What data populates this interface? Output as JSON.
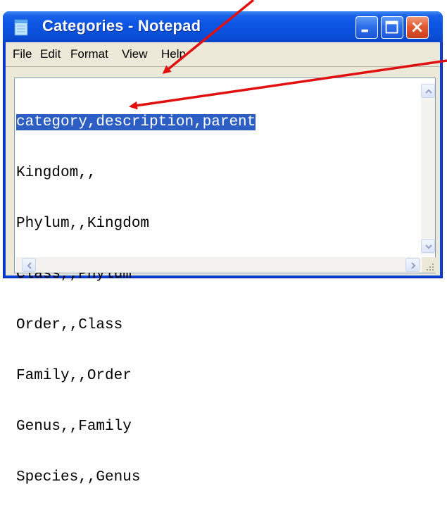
{
  "window": {
    "title": "Categories - Notepad",
    "app_icon": "notepad-icon",
    "controls": [
      "minimize-icon",
      "maximize-icon",
      "close-icon"
    ]
  },
  "menubar": {
    "items": [
      "File",
      "Edit",
      "Format",
      "View",
      "Help"
    ]
  },
  "editor": {
    "lines": [
      "category,description,parent",
      "Kingdom,,",
      "Phylum,,Kingdom",
      "Class,,Phylum",
      "Order,,Class",
      "Family,,Order",
      "Genus,,Family",
      "Species,,Genus"
    ],
    "selected_line": "category,description,parent"
  },
  "colors": {
    "titlebar": "#0a4fd8",
    "selection": "#2d5ec4",
    "annotation_arrow": "#e01010"
  }
}
